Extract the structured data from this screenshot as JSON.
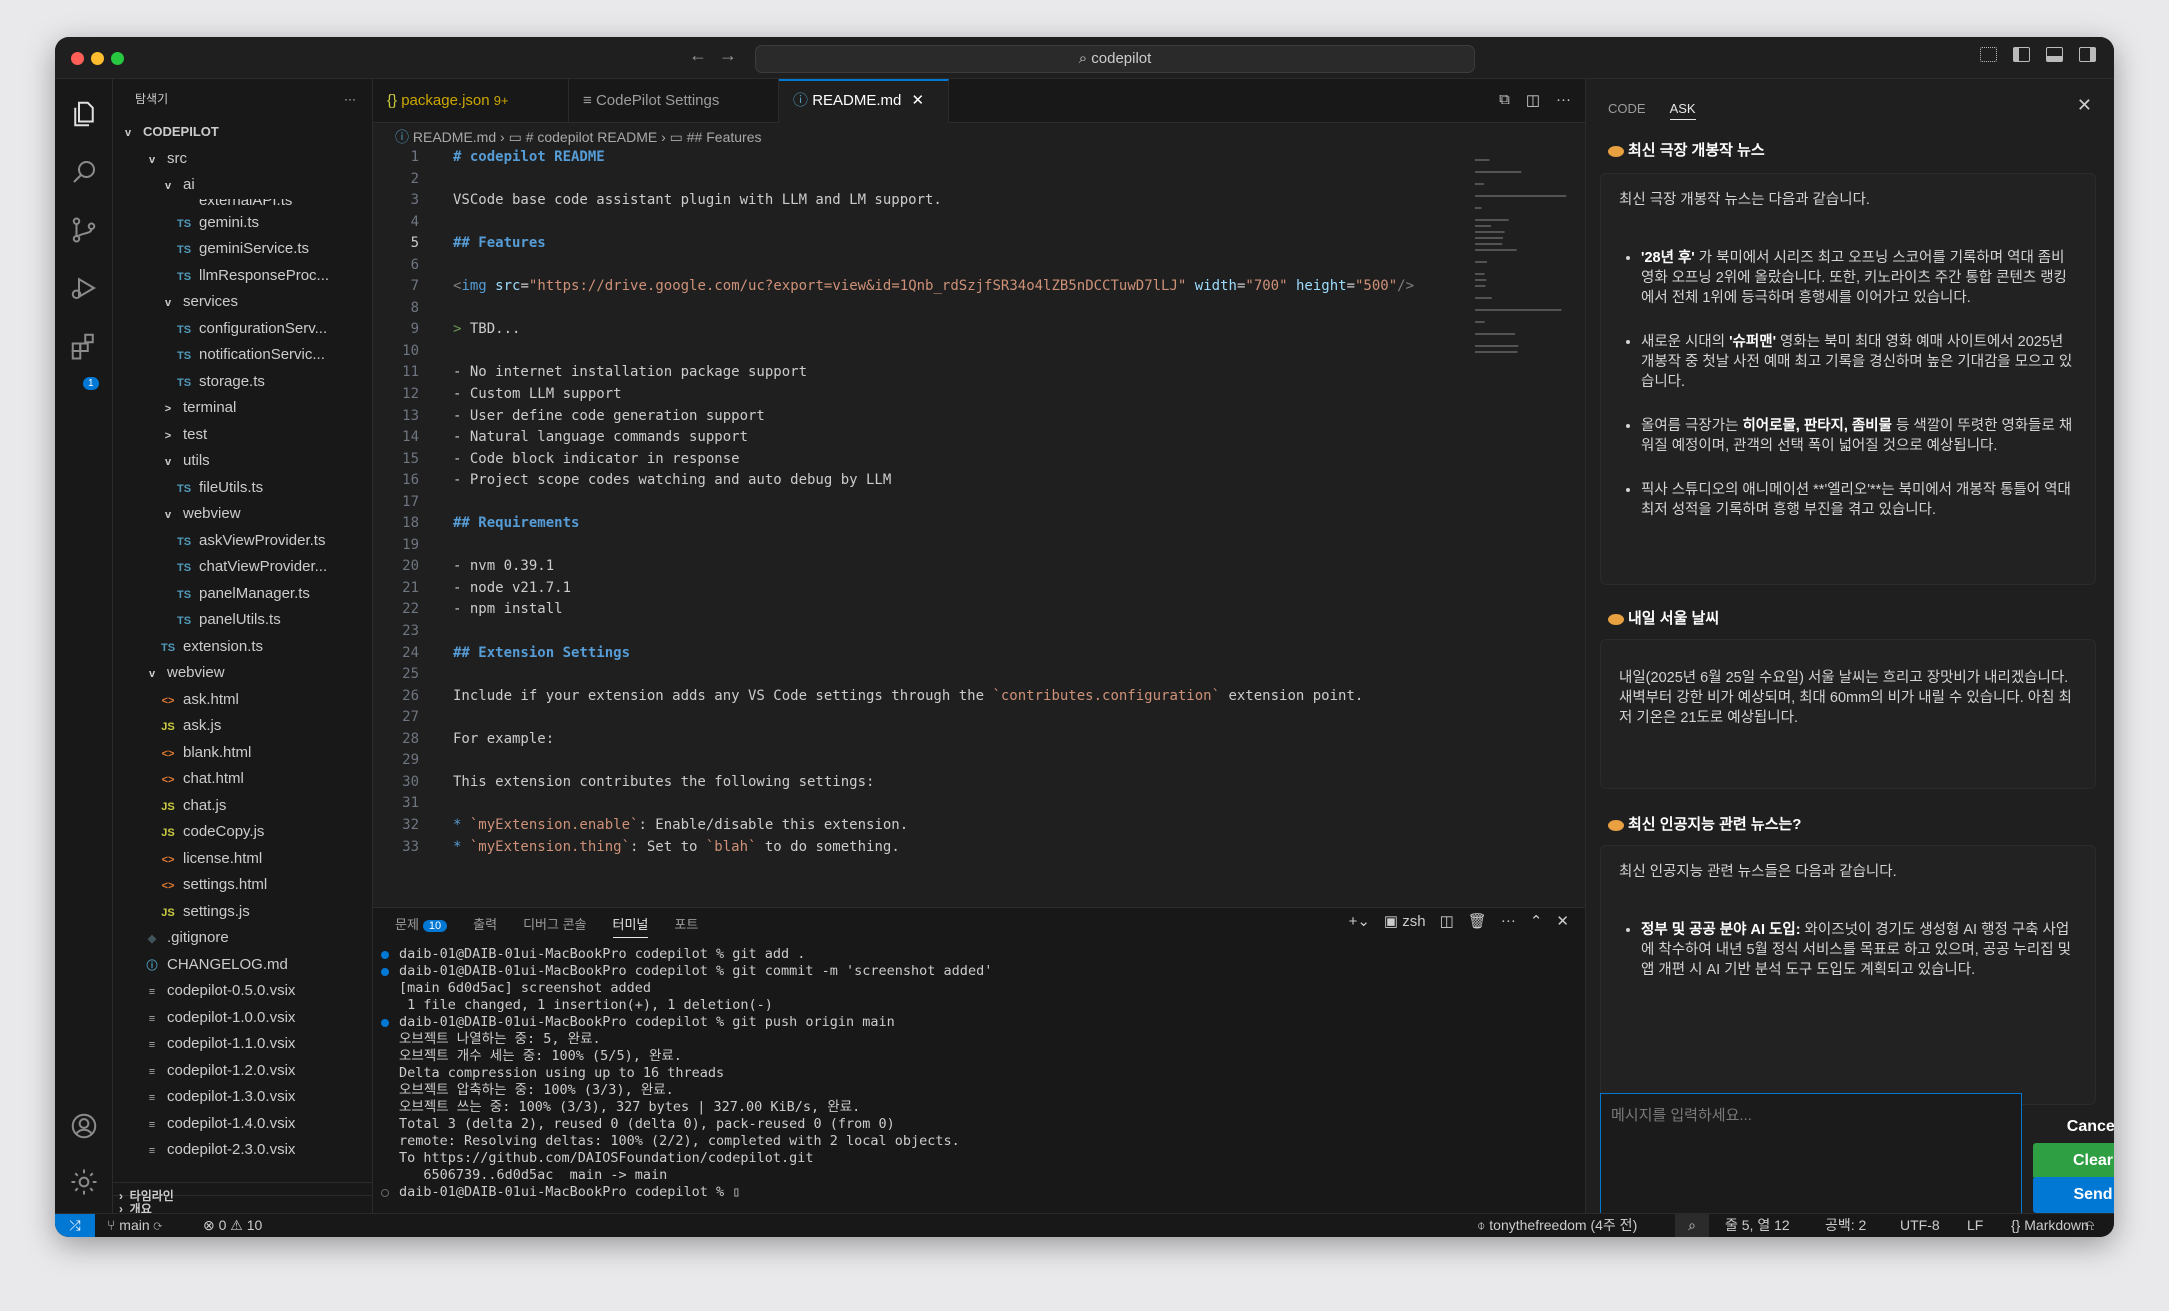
{
  "search": {
    "text": "codepilot"
  },
  "explorer": {
    "title": "탐색기",
    "root": "CODEPILOT",
    "rows": [
      {
        "ic": "v",
        "cls": "chev",
        "label": "src",
        "indent": 30
      },
      {
        "ic": "v",
        "cls": "chev",
        "label": "ai",
        "indent": 46
      },
      {
        "ic": "",
        "cls": "",
        "label": "externalAPI.ts",
        "indent": 62,
        "cut": true
      },
      {
        "ic": "TS",
        "cls": "ts",
        "label": "gemini.ts",
        "indent": 62
      },
      {
        "ic": "TS",
        "cls": "ts",
        "label": "geminiService.ts",
        "indent": 62
      },
      {
        "ic": "TS",
        "cls": "ts",
        "label": "llmResponseProc...",
        "indent": 62
      },
      {
        "ic": "v",
        "cls": "chev",
        "label": "services",
        "indent": 46
      },
      {
        "ic": "TS",
        "cls": "ts",
        "label": "configurationServ...",
        "indent": 62
      },
      {
        "ic": "TS",
        "cls": "ts",
        "label": "notificationServic...",
        "indent": 62
      },
      {
        "ic": "TS",
        "cls": "ts",
        "label": "storage.ts",
        "indent": 62
      },
      {
        "ic": ">",
        "cls": "chev",
        "label": "terminal",
        "indent": 46
      },
      {
        "ic": ">",
        "cls": "chev",
        "label": "test",
        "indent": 46
      },
      {
        "ic": "v",
        "cls": "chev",
        "label": "utils",
        "indent": 46
      },
      {
        "ic": "TS",
        "cls": "ts",
        "label": "fileUtils.ts",
        "indent": 62
      },
      {
        "ic": "v",
        "cls": "chev",
        "label": "webview",
        "indent": 46
      },
      {
        "ic": "TS",
        "cls": "ts",
        "label": "askViewProvider.ts",
        "indent": 62
      },
      {
        "ic": "TS",
        "cls": "ts",
        "label": "chatViewProvider...",
        "indent": 62
      },
      {
        "ic": "TS",
        "cls": "ts",
        "label": "panelManager.ts",
        "indent": 62
      },
      {
        "ic": "TS",
        "cls": "ts",
        "label": "panelUtils.ts",
        "indent": 62
      },
      {
        "ic": "TS",
        "cls": "ts",
        "label": "extension.ts",
        "indent": 46
      },
      {
        "ic": "v",
        "cls": "chev",
        "label": "webview",
        "indent": 30
      },
      {
        "ic": "<>",
        "cls": "html",
        "label": "ask.html",
        "indent": 46
      },
      {
        "ic": "JS",
        "cls": "js",
        "label": "ask.js",
        "indent": 46
      },
      {
        "ic": "<>",
        "cls": "html",
        "label": "blank.html",
        "indent": 46
      },
      {
        "ic": "<>",
        "cls": "html",
        "label": "chat.html",
        "indent": 46
      },
      {
        "ic": "JS",
        "cls": "js",
        "label": "chat.js",
        "indent": 46
      },
      {
        "ic": "JS",
        "cls": "js",
        "label": "codeCopy.js",
        "indent": 46
      },
      {
        "ic": "<>",
        "cls": "html",
        "label": "license.html",
        "indent": 46
      },
      {
        "ic": "<>",
        "cls": "html",
        "label": "settings.html",
        "indent": 46
      },
      {
        "ic": "JS",
        "cls": "js",
        "label": "settings.js",
        "indent": 46
      },
      {
        "ic": "◆",
        "cls": "git",
        "label": ".gitignore",
        "indent": 30
      },
      {
        "ic": "ⓘ",
        "cls": "md",
        "label": "CHANGELOG.md",
        "indent": 30
      },
      {
        "ic": "≡",
        "cls": "vsix",
        "label": "codepilot-0.5.0.vsix",
        "indent": 30
      },
      {
        "ic": "≡",
        "cls": "vsix",
        "label": "codepilot-1.0.0.vsix",
        "indent": 30
      },
      {
        "ic": "≡",
        "cls": "vsix",
        "label": "codepilot-1.1.0.vsix",
        "indent": 30
      },
      {
        "ic": "≡",
        "cls": "vsix",
        "label": "codepilot-1.2.0.vsix",
        "indent": 30
      },
      {
        "ic": "≡",
        "cls": "vsix",
        "label": "codepilot-1.3.0.vsix",
        "indent": 30
      },
      {
        "ic": "≡",
        "cls": "vsix",
        "label": "codepilot-1.4.0.vsix",
        "indent": 30
      },
      {
        "ic": "≡",
        "cls": "vsix",
        "label": "codepilot-2.3.0.vsix",
        "indent": 30
      }
    ],
    "outline": "개요",
    "timeline": "타임라인"
  },
  "tabs": [
    {
      "label": "package.json",
      "extra": "9+",
      "icon": "{}"
    },
    {
      "label": "CodePilot Settings",
      "icon": "≡"
    },
    {
      "label": "README.md",
      "icon": "ⓘ",
      "close": "✕"
    }
  ],
  "breadcrumb": {
    "file": "README.md",
    "h1": "# codepilot README",
    "h2": "## Features"
  },
  "code": [
    [
      {
        "c": "hd",
        "t": "# codepilot README"
      }
    ],
    [],
    [
      {
        "t": "VSCode base code assistant plugin with LLM and LM support."
      }
    ],
    [],
    [
      {
        "c": "hd",
        "t": "## Features"
      }
    ],
    [],
    [
      {
        "c": "tg",
        "t": "<"
      },
      {
        "c": "tn",
        "t": "img"
      },
      {
        "t": " "
      },
      {
        "c": "an",
        "t": "src"
      },
      {
        "t": "="
      },
      {
        "c": "av",
        "t": "\"https://drive.google.com/uc?export=view&id=1Qnb_rdSzjfSR34o4lZB5nDCCTuwD7lLJ\""
      },
      {
        "t": " "
      },
      {
        "c": "an",
        "t": "width"
      },
      {
        "t": "="
      },
      {
        "c": "av",
        "t": "\"700\""
      },
      {
        "t": " "
      },
      {
        "c": "an",
        "t": "height"
      },
      {
        "t": "="
      },
      {
        "c": "av",
        "t": "\"500\""
      },
      {
        "c": "tg",
        "t": "/>"
      }
    ],
    [],
    [
      {
        "c": "bq",
        "t": "> "
      },
      {
        "t": "TBD..."
      }
    ],
    [],
    [
      {
        "t": "- No internet installation package support"
      }
    ],
    [
      {
        "t": "- Custom LLM support"
      }
    ],
    [
      {
        "t": "- User define code generation support"
      }
    ],
    [
      {
        "t": "- Natural language commands support"
      }
    ],
    [
      {
        "t": "- Code block indicator in response"
      }
    ],
    [
      {
        "t": "- Project scope codes watching and auto debug by LLM"
      }
    ],
    [],
    [
      {
        "c": "hd",
        "t": "## Requirements"
      }
    ],
    [],
    [
      {
        "t": "- nvm 0.39.1"
      }
    ],
    [
      {
        "t": "- node v21.7.1"
      }
    ],
    [
      {
        "t": "- npm install"
      }
    ],
    [],
    [
      {
        "c": "hd",
        "t": "## Extension Settings"
      }
    ],
    [],
    [
      {
        "t": "Include if your extension adds any VS Code settings through the "
      },
      {
        "c": "inl",
        "t": "`contributes.configuration`"
      },
      {
        "t": " extension point."
      }
    ],
    [],
    [
      {
        "t": "For example:"
      }
    ],
    [],
    [
      {
        "t": "This extension contributes the following settings:"
      }
    ],
    [],
    [
      {
        "c": "tn",
        "t": "* "
      },
      {
        "c": "inl",
        "t": "`myExtension.enable`"
      },
      {
        "t": ": Enable/disable this extension."
      }
    ],
    [
      {
        "c": "tn",
        "t": "* "
      },
      {
        "c": "inl",
        "t": "`myExtension.thing`"
      },
      {
        "t": ": Set to "
      },
      {
        "c": "inl",
        "t": "`blah`"
      },
      {
        "t": " to do something."
      }
    ]
  ],
  "panel": {
    "tabs": [
      "문제",
      "출력",
      "디버그 콘솔",
      "터미널",
      "포트"
    ],
    "problems_count": "10",
    "shell": "zsh",
    "lines": [
      {
        "dot": "blue",
        "t": "daib-01@DAIB-01ui-MacBookPro codepilot % git add ."
      },
      {
        "dot": "blue",
        "t": "daib-01@DAIB-01ui-MacBookPro codepilot % git commit -m 'screenshot added'"
      },
      {
        "t": "[main 6d0d5ac] screenshot added"
      },
      {
        "t": " 1 file changed, 1 insertion(+), 1 deletion(-)"
      },
      {
        "dot": "blue",
        "t": "daib-01@DAIB-01ui-MacBookPro codepilot % git push origin main"
      },
      {
        "t": "오브젝트 나열하는 중: 5, 완료."
      },
      {
        "t": "오브젝트 개수 세는 중: 100% (5/5), 완료."
      },
      {
        "t": "Delta compression using up to 16 threads"
      },
      {
        "t": "오브젝트 압축하는 중: 100% (3/3), 완료."
      },
      {
        "t": "오브젝트 쓰는 중: 100% (3/3), 327 bytes | 327.00 KiB/s, 완료."
      },
      {
        "t": "Total 3 (delta 2), reused 0 (delta 0), pack-reused 0 (from 0)"
      },
      {
        "t": "remote: Resolving deltas: 100% (2/2), completed with 2 local objects."
      },
      {
        "t": "To https://github.com/DAIOSFoundation/codepilot.git"
      },
      {
        "t": "   6506739..6d0d5ac  main -> main"
      },
      {
        "dot": "hollow",
        "t": "daib-01@DAIB-01ui-MacBookPro codepilot % ▯"
      }
    ]
  },
  "ask": {
    "tab_code": "CODE",
    "tab_ask": "ASK",
    "q1": "최신 극장 개봉작 뉴스",
    "a1_intro": "최신 극장 개봉작 뉴스는 다음과 같습니다.",
    "a1_items": [
      [
        {
          "b": "'28년 후'"
        },
        {
          "t": " 가 북미에서 시리즈 최고 오프닝 스코어를 기록하며 역대 좀비 영화 오프닝 2위에 올랐습니다. 또한, 키노라이츠 주간 통합 콘텐츠 랭킹에서 전체 1위에 등극하며 흥행세를 이어가고 있습니다."
        }
      ],
      [
        {
          "t": "새로운 시대의 "
        },
        {
          "b": "'슈퍼맨'"
        },
        {
          "t": " 영화는 북미 최대 영화 예매 사이트에서 2025년 개봉작 중 첫날 사전 예매 최고 기록을 경신하며 높은 기대감을 모으고 있습니다."
        }
      ],
      [
        {
          "t": "올여름 극장가는 "
        },
        {
          "b": "히어로물, 판타지, 좀비물"
        },
        {
          "t": " 등 색깔이 뚜렷한 영화들로 채워질 예정이며, 관객의 선택 폭이 넓어질 것으로 예상됩니다."
        }
      ],
      [
        {
          "t": "픽사 스튜디오의 애니메이션 **'엘리오'**는 북미에서 개봉작 통틀어 역대 최저 성적을 기록하며 흥행 부진을 겪고 있습니다."
        }
      ]
    ],
    "q2": "내일 서울 날씨",
    "a2": "내일(2025년 6월 25일 수요일) 서울 날씨는 흐리고 장맛비가 내리겠습니다. 새벽부터 강한 비가 예상되며, 최대 60mm의 비가 내릴 수 있습니다. 아침 최저 기온은 21도로 예상됩니다.",
    "q3": "최신 인공지능 관련 뉴스는?",
    "a3_intro": "최신 인공지능 관련 뉴스들은 다음과 같습니다.",
    "a3_items": [
      [
        {
          "b": "정부 및 공공 분야 AI 도입:"
        },
        {
          "t": " 와이즈넛이 경기도 생성형 AI 행정 구축 사업에 착수하여 내년 5월 정식 서비스를 목표로 하고 있으며, 공공 누리집 및 앱 개편 시 AI 기반 분석 도구 도입도 계획되고 있습니다."
        }
      ]
    ],
    "placeholder": "메시지를 입력하세요...",
    "cancel": "Cancel",
    "clear": "Clear",
    "send": "Send",
    "clear_color": "#2ea043",
    "send_color": "#0078d4"
  },
  "status": {
    "branch": "main",
    "errors": "0",
    "warnings": "10",
    "blame": "tonythefreedom (4주 전)",
    "position": "줄 5, 열 12",
    "spaces": "공백: 2",
    "encoding": "UTF-8",
    "eol": "LF",
    "language": "Markdown"
  }
}
